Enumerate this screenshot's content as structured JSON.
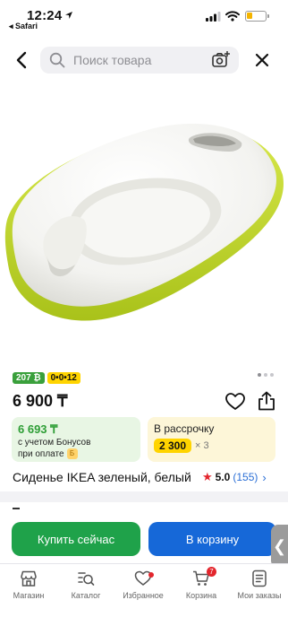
{
  "status_bar": {
    "time": "12:24",
    "back_app": "◂ Safari"
  },
  "search": {
    "placeholder": "Поиск товара"
  },
  "product": {
    "image_name": "toilet-training-seat-image",
    "badges": [
      "207 ₿",
      "0•0•12"
    ],
    "image_pages": 3,
    "image_page_active": 1,
    "price": "6 900 ₸",
    "bonus": {
      "amount": "6 693 ₸",
      "line1": "с учетом Бонусов",
      "line2": "при оплате",
      "coin": "Б"
    },
    "installment": {
      "title": "В рассрочку",
      "amount": "2 300",
      "multiplier": "× 3"
    },
    "name": "Сиденье IKEA зеленый, белый",
    "rating": {
      "score": "5.0",
      "reviews": "(155)"
    }
  },
  "actions": {
    "buy_now": "Купить сейчас",
    "add_to_cart": "В корзину",
    "side_handle": "❮"
  },
  "tabbar": {
    "items": [
      {
        "label": "Магазин",
        "icon": "store-icon"
      },
      {
        "label": "Каталог",
        "icon": "catalog-search-icon"
      },
      {
        "label": "Избранное",
        "icon": "heart-icon"
      },
      {
        "label": "Корзина",
        "icon": "cart-icon",
        "badge": "7"
      },
      {
        "label": "Мои заказы",
        "icon": "orders-icon"
      }
    ]
  },
  "colors": {
    "green": "#1fa24a",
    "blue": "#1668d8",
    "yellow": "#ffd400",
    "red": "#e3262d"
  }
}
